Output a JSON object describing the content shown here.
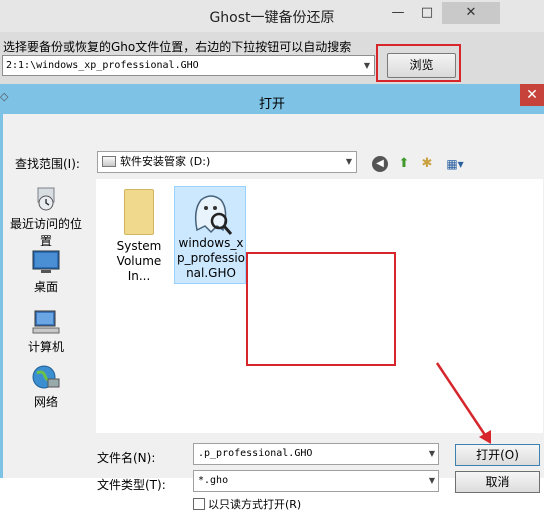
{
  "ghost_window": {
    "title": "Ghost一键备份还原",
    "min_glyph": "—",
    "max_glyph": "□",
    "close_glyph": "✕",
    "prompt": "选择要备份或恢复的Gho文件位置，右边的下拉按钮可以自动搜索",
    "path_value": "2:1:\\windows_xp_professional.GHO",
    "browse_label": "浏览"
  },
  "dialog": {
    "title": "打开",
    "close_glyph": "✕",
    "look_in_label": "查找范围(I):",
    "look_in_value": "软件安装管家  (D:)",
    "places": [
      {
        "label": "最近访问的位置",
        "icon": "recent-places-icon"
      },
      {
        "label": "桌面",
        "icon": "desktop-icon"
      },
      {
        "label": "计算机",
        "icon": "computer-icon"
      },
      {
        "label": "网络",
        "icon": "network-icon"
      }
    ],
    "files": [
      {
        "label": "System Volume In...",
        "icon": "folder-icon"
      },
      {
        "label": "windows_xp_professional.GHO",
        "icon": "ghost-file-icon"
      }
    ],
    "filename_label": "文件名(N):",
    "filename_value": ".p_professional.GHO",
    "filetype_label": "文件类型(T):",
    "filetype_value": "*.gho",
    "readonly_label": "以只读方式打开(R)",
    "open_label": "打开(O)",
    "cancel_label": "取消"
  },
  "colors": {
    "highlight": "#d6262c",
    "dialog_frame": "#7ec2e6",
    "selection": "#cce8ff"
  }
}
